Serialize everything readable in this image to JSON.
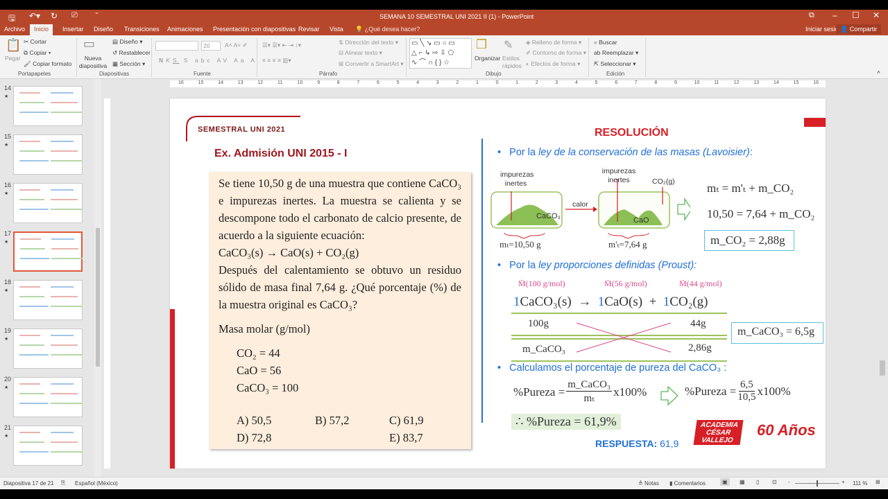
{
  "window": {
    "title": "SEMANA 10 SEMESTRAL UNI 2021 II (1) - PowerPoint"
  },
  "menu": {
    "tabs": [
      "Archivo",
      "Inicio",
      "Insertar",
      "Diseño",
      "Transiciones",
      "Animaciones",
      "Presentación con diapositivas",
      "Revisar",
      "Vista"
    ],
    "tellme": "¿Qué desea hacer?",
    "signin": "Iniciar sesión",
    "share": "Compartir"
  },
  "ribbon": {
    "clipboard": {
      "paste": "Pegar",
      "cut": "Cortar",
      "copy": "Copiar",
      "format": "Copiar formato",
      "label": "Portapapeles"
    },
    "slides": {
      "new": "Nueva diapositiva",
      "layout": "Diseño",
      "reset": "Restablecer",
      "section": "Sección",
      "label": "Diapositivas"
    },
    "font": {
      "size": "20",
      "label": "Fuente",
      "b": "N",
      "i": "K",
      "u": "S"
    },
    "paragraph": {
      "dir": "Dirección del texto",
      "align": "Alinear texto",
      "smartart": "Convertir a SmartArt",
      "label": "Párrafo"
    },
    "drawing": {
      "arrange": "Organizar",
      "styles": "Estilos rápidos",
      "fill": "Relleno de forma",
      "outline": "Contorno de forma",
      "effects": "Efectos de forma",
      "label": "Dibujo"
    },
    "editing": {
      "find": "Buscar",
      "replace": "Reemplazar",
      "select": "Seleccionar",
      "label": "Edición"
    }
  },
  "thumbnails": [
    "14",
    "15",
    "16",
    "17",
    "18",
    "19",
    "20",
    "21"
  ],
  "ruler": [
    "16",
    "15",
    "14",
    "13",
    "12",
    "11",
    "10",
    "9",
    "8",
    "7",
    "6",
    "5",
    "4",
    "3",
    "2",
    "1",
    "0",
    "1",
    "2",
    "3",
    "4",
    "5",
    "6",
    "7",
    "8",
    "9",
    "10",
    "11",
    "12",
    "13",
    "14",
    "15",
    "16"
  ],
  "slide": {
    "header": "SEMESTRAL UNI 2021",
    "exam": "Ex. Admisión UNI 2015 - I",
    "problem": {
      "p1": "Se tiene 10,50 g de una muestra que contiene CaCO₃ e impurezas inertes. La muestra se calienta y se descompone todo el carbonato de calcio presente, de acuerdo a la siguiente ecuación:",
      "eq": "CaCO₃(s)  →  CaO(s) + CO₂(g)",
      "p2": "Después del calentamiento se obtuvo un residuo sólido de masa final 7,64 g. ¿Qué porcentaje (%) de la muestra original es CaCO₃?",
      "molar_title": "Masa molar (g/mol)",
      "molar": [
        "CO₂ = 44",
        "CaO = 56",
        "CaCO₃ = 100"
      ],
      "options": [
        "A)  50,5",
        "B)  57,2",
        "C)  61,9",
        "D)  72,8",
        "E)  83,7"
      ]
    },
    "resolution": {
      "title": "RESOLUCIÓN",
      "b1_pre": "Por la ",
      "b1_it": "ley de la conservación de las masas (Lavoisier)",
      "b1_post": ":",
      "imp1": "impurezas inertes",
      "caco3": "CaCO₃",
      "calor": "calor",
      "imp2": "impurezas inertes",
      "co2g": "CO₂(g)",
      "cao": "CaO",
      "mt": "mₜ=10,50 g",
      "mt2": "m'ₜ=7,64 g",
      "eq1": "mₜ = m'ₜ + m_CO₂",
      "eq2": "10,50 = 7,64 + m_CO₂",
      "res1": "m_CO₂ =  2,88g",
      "b2_pre": "Por la ",
      "b2_it": "ley proporciones definidas (Proust):",
      "mm": [
        "M̄(100 g/mol)",
        "M̄(56 g/mol)",
        "M̄(44 g/mol)"
      ],
      "coef": "1",
      "sp": [
        "CaCO₃(s)",
        "CaO(s)",
        "CO₂(g)"
      ],
      "arrow": "→",
      "plus": "+",
      "r1": [
        "100g",
        "44g"
      ],
      "r2": [
        "m_CaCO₃",
        "2,86g"
      ],
      "res2": "m_CaCO₃ = 6,5g",
      "b3": "Calculamos el porcentaje de pureza del CaCO₃ :",
      "f1": "%Pureza =",
      "f1num": "m_CaCO₃",
      "f1den": "mₜ",
      "x100": "x100%",
      "f2": "%Pureza =",
      "f2num": "6,5",
      "f2den": "10,5",
      "final": "∴ %Pureza = 61,9%",
      "answer_label": "RESPUESTA:",
      "answer": "61,9",
      "logo1": "ACADEMIA CÉSAR VALLEJO",
      "logo2": "60 Años"
    }
  },
  "status": {
    "slide": "Diapositiva 17 de 21",
    "lang": "Español (México)",
    "notes": "Notas",
    "comments": "Comentarios",
    "zoom": "111 %"
  }
}
